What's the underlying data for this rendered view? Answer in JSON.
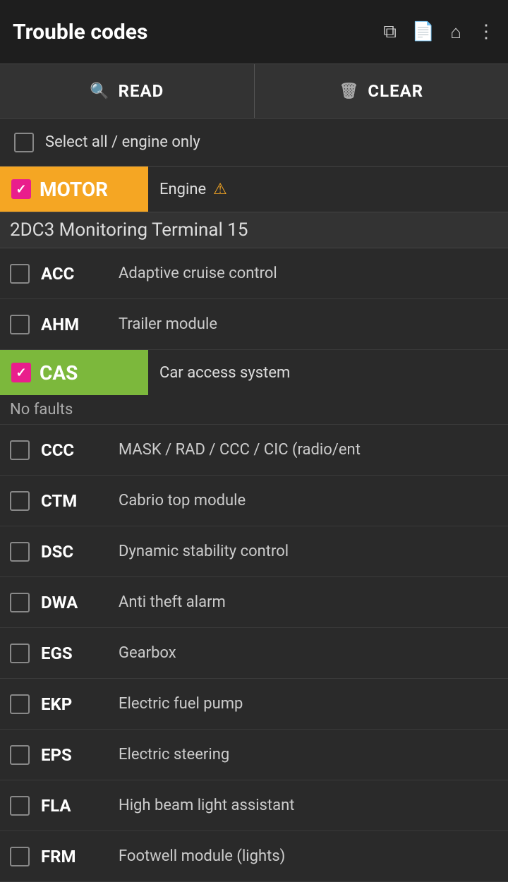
{
  "header": {
    "title": "Trouble codes",
    "icons": [
      "copy",
      "file",
      "home",
      "more-vert"
    ]
  },
  "toolbar": {
    "read_label": "READ",
    "clear_label": "CLEAR",
    "read_icon": "🔍",
    "clear_icon": "🗑"
  },
  "select_all": {
    "label": "Select all / engine only",
    "checked": false
  },
  "motor_module": {
    "tag": "MOTOR",
    "description": "Engine",
    "has_warning": true,
    "checked": true
  },
  "section_title": "2DC3 Monitoring Terminal 15",
  "items": [
    {
      "code": "ACC",
      "description": "Adaptive cruise control",
      "checked": false
    },
    {
      "code": "AHM",
      "description": "Trailer module",
      "checked": false
    },
    {
      "code": "CAS",
      "description": "Car access system",
      "checked": true,
      "highlight": true
    },
    {
      "code": "CCC",
      "description": "MASK / RAD / CCC / CIC (radio/ent",
      "checked": false
    },
    {
      "code": "CTM",
      "description": "Cabrio top module",
      "checked": false
    },
    {
      "code": "DSC",
      "description": "Dynamic stability control",
      "checked": false
    },
    {
      "code": "DWA",
      "description": "Anti theft alarm",
      "checked": false
    },
    {
      "code": "EGS",
      "description": "Gearbox",
      "checked": false
    },
    {
      "code": "EKP",
      "description": "Electric fuel pump",
      "checked": false
    },
    {
      "code": "EPS",
      "description": "Electric steering",
      "checked": false
    },
    {
      "code": "FLA",
      "description": "High beam light assistant",
      "checked": false
    },
    {
      "code": "FRM",
      "description": "Footwell module (lights)",
      "checked": false
    }
  ],
  "cas_status": "No faults"
}
